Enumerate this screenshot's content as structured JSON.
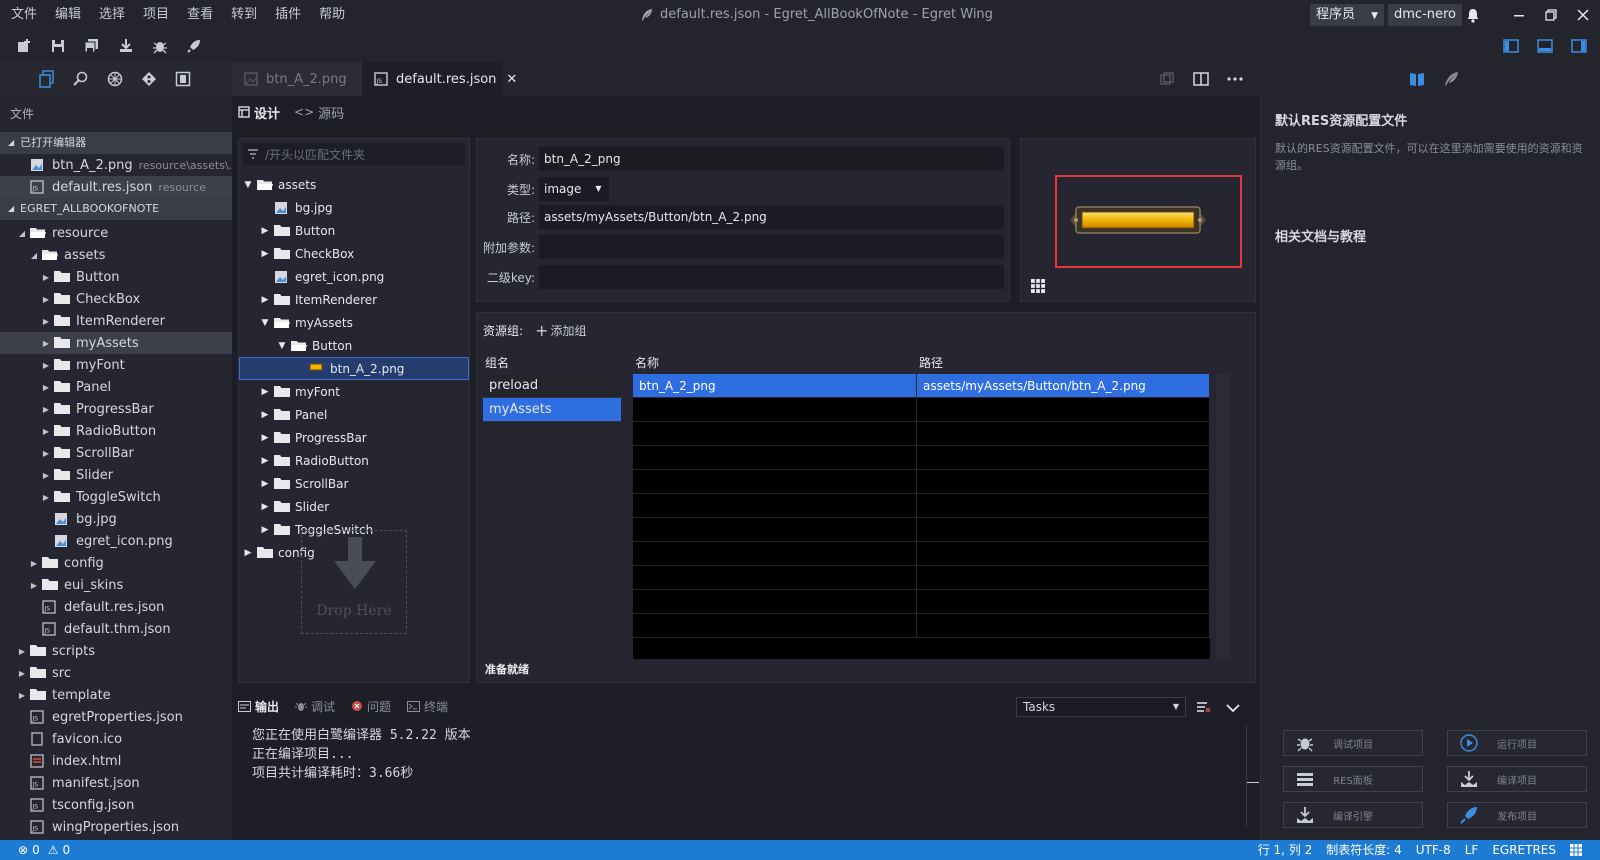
{
  "colors": {
    "accent": "#1e7bd4",
    "selection": "#2f6ee0",
    "highlight_box": "#e53935",
    "folder": "#e8e8ea"
  },
  "menu": [
    "文件",
    "编辑",
    "选择",
    "项目",
    "查看",
    "转到",
    "插件",
    "帮助"
  ],
  "window_title": "default.res.json - Egret_AllBookOfNote - Egret Wing",
  "account": {
    "role": "程序员",
    "user": "dmc-nero"
  },
  "explorer": {
    "title": "文件",
    "open_editors_label": "已打开编辑器",
    "open_editors": [
      {
        "name": "btn_A_2.png",
        "path": "resource\\assets\\..."
      },
      {
        "name": "default.res.json",
        "path": "resource"
      }
    ],
    "project_label": "EGRET_ALLBOOKOFNOTE",
    "tree": [
      {
        "name": "resource",
        "level": 1,
        "type": "folder",
        "open": true
      },
      {
        "name": "assets",
        "level": 2,
        "type": "folder",
        "open": true
      },
      {
        "name": "Button",
        "level": 3,
        "type": "folder"
      },
      {
        "name": "CheckBox",
        "level": 3,
        "type": "folder"
      },
      {
        "name": "ItemRenderer",
        "level": 3,
        "type": "folder"
      },
      {
        "name": "myAssets",
        "level": 3,
        "type": "folder",
        "selected": true
      },
      {
        "name": "myFont",
        "level": 3,
        "type": "folder"
      },
      {
        "name": "Panel",
        "level": 3,
        "type": "folder"
      },
      {
        "name": "ProgressBar",
        "level": 3,
        "type": "folder"
      },
      {
        "name": "RadioButton",
        "level": 3,
        "type": "folder"
      },
      {
        "name": "ScrollBar",
        "level": 3,
        "type": "folder"
      },
      {
        "name": "Slider",
        "level": 3,
        "type": "folder"
      },
      {
        "name": "ToggleSwitch",
        "level": 3,
        "type": "folder"
      },
      {
        "name": "bg.jpg",
        "level": 3,
        "type": "image"
      },
      {
        "name": "egret_icon.png",
        "level": 3,
        "type": "image"
      },
      {
        "name": "config",
        "level": 2,
        "type": "folder"
      },
      {
        "name": "eui_skins",
        "level": 2,
        "type": "folder"
      },
      {
        "name": "default.res.json",
        "level": 2,
        "type": "json"
      },
      {
        "name": "default.thm.json",
        "level": 2,
        "type": "json"
      },
      {
        "name": "scripts",
        "level": 1,
        "type": "folder"
      },
      {
        "name": "src",
        "level": 1,
        "type": "folder"
      },
      {
        "name": "template",
        "level": 1,
        "type": "folder"
      },
      {
        "name": "egretProperties.json",
        "level": 1,
        "type": "json"
      },
      {
        "name": "favicon.ico",
        "level": 1,
        "type": "file"
      },
      {
        "name": "index.html",
        "level": 1,
        "type": "html"
      },
      {
        "name": "manifest.json",
        "level": 1,
        "type": "json"
      },
      {
        "name": "tsconfig.json",
        "level": 1,
        "type": "json"
      },
      {
        "name": "wingProperties.json",
        "level": 1,
        "type": "json"
      }
    ]
  },
  "tabs": [
    {
      "label": "btn_A_2.png",
      "active": false
    },
    {
      "label": "default.res.json",
      "active": true
    }
  ],
  "view_modes": {
    "design": "设计",
    "source": "源码"
  },
  "file_tree": {
    "filter_placeholder": "/开头以匹配文件夹",
    "items": [
      {
        "name": "assets",
        "level": 0,
        "type": "folder",
        "open": true
      },
      {
        "name": "bg.jpg",
        "level": 1,
        "type": "image"
      },
      {
        "name": "Button",
        "level": 1,
        "type": "folder"
      },
      {
        "name": "CheckBox",
        "level": 1,
        "type": "folder"
      },
      {
        "name": "egret_icon.png",
        "level": 1,
        "type": "image"
      },
      {
        "name": "ItemRenderer",
        "level": 1,
        "type": "folder"
      },
      {
        "name": "myAssets",
        "level": 1,
        "type": "folder",
        "open": true
      },
      {
        "name": "Button",
        "level": 2,
        "type": "folder",
        "open": true
      },
      {
        "name": "btn_A_2.png",
        "level": 3,
        "type": "png",
        "selected": true
      },
      {
        "name": "myFont",
        "level": 1,
        "type": "folder"
      },
      {
        "name": "Panel",
        "level": 1,
        "type": "folder"
      },
      {
        "name": "ProgressBar",
        "level": 1,
        "type": "folder"
      },
      {
        "name": "RadioButton",
        "level": 1,
        "type": "folder"
      },
      {
        "name": "ScrollBar",
        "level": 1,
        "type": "folder"
      },
      {
        "name": "Slider",
        "level": 1,
        "type": "folder"
      },
      {
        "name": "ToggleSwitch",
        "level": 1,
        "type": "folder"
      },
      {
        "name": "config",
        "level": 0,
        "type": "folder"
      }
    ],
    "drop_here": "Drop Here"
  },
  "properties": {
    "name_label": "名称:",
    "name_value": "btn_A_2_png",
    "type_label": "类型:",
    "type_value": "image",
    "path_label": "路径:",
    "path_value": "assets/myAssets/Button/btn_A_2.png",
    "params_label": "附加参数:",
    "params_value": "",
    "subkey_label": "二级key:",
    "subkey_value": ""
  },
  "resource_groups": {
    "label": "资源组:",
    "add_group": "添加组",
    "group_col": "组名",
    "name_col": "名称",
    "path_col": "路径",
    "groups": [
      {
        "name": "preload",
        "selected": false
      },
      {
        "name": "myAssets",
        "selected": true
      }
    ],
    "rows": [
      {
        "name": "btn_A_2_png",
        "path": "assets/myAssets/Button/btn_A_2.png",
        "selected": true
      }
    ],
    "status": "准备就绪"
  },
  "output": {
    "tabs": [
      "输出",
      "调试",
      "问题",
      "终端"
    ],
    "tasks_select": "Tasks",
    "lines": [
      "您正在使用白鹭编译器 5.2.22 版本",
      "正在编译项目...",
      "项目共计编译耗时：3.66秒"
    ]
  },
  "right_panel": {
    "title1": "默认RES资源配置文件",
    "desc1": "默认的RES资源配置文件，可以在这里添加需要使用的资源和资源组。",
    "title2": "相关文档与教程",
    "actions": [
      {
        "label": "调试项目",
        "icon": "bug-icon"
      },
      {
        "label": "运行项目",
        "icon": "play-icon"
      },
      {
        "label": "RES面板",
        "icon": "res-panel-icon"
      },
      {
        "label": "编译项目",
        "icon": "build-icon"
      },
      {
        "label": "编译引擎",
        "icon": "build-engine-icon"
      },
      {
        "label": "发布项目",
        "icon": "publish-icon"
      }
    ]
  },
  "status_bar": {
    "errors": "0",
    "warnings": "0",
    "position": "行 1, 列 2",
    "tab_size": "制表符长度: 4",
    "encoding": "UTF-8",
    "eol": "LF",
    "language": "EGRETRES"
  }
}
